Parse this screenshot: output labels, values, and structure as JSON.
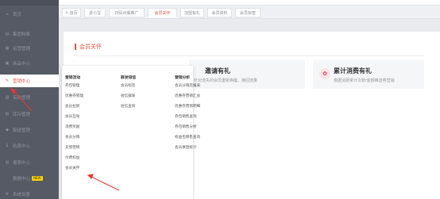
{
  "colors": {
    "accent": "#e0543e",
    "sidebar_bg": "#555a65",
    "arrow": "#e23b2e"
  },
  "sidebar": {
    "items": [
      {
        "label": "首页",
        "icon": "home-icon",
        "glyph": "⌂"
      },
      {
        "label": "集团档案",
        "icon": "group-icon",
        "glyph": "▤"
      },
      {
        "label": "运营管理",
        "icon": "operations-icon",
        "glyph": "▦"
      },
      {
        "label": "商品中心",
        "icon": "goods-icon",
        "glyph": "▣"
      },
      {
        "label": "营销中心",
        "icon": "marketing-icon",
        "glyph": "✎"
      },
      {
        "label": "采购管理",
        "icon": "purchase-icon",
        "glyph": "▨"
      },
      {
        "label": "库存管理",
        "icon": "inventory-icon",
        "glyph": "▧"
      },
      {
        "label": "配送管理",
        "icon": "delivery-icon",
        "glyph": "◆"
      },
      {
        "label": "结算中心",
        "icon": "settlement-icon",
        "glyph": "$"
      },
      {
        "label": "报表中心",
        "icon": "report-icon",
        "glyph": "▥"
      },
      {
        "label": "数据中心",
        "icon": "data-icon",
        "glyph": "",
        "badge": "NEW"
      },
      {
        "label": "系统设置",
        "icon": "settings-icon",
        "glyph": "⚙"
      }
    ],
    "active_index": 4
  },
  "tabs": [
    {
      "label": "首页",
      "icon": "home-icon",
      "glyph": "⌂"
    },
    {
      "label": "进小宝"
    },
    {
      "label": "扫码点餐推广"
    },
    {
      "label": "会员关怀"
    },
    {
      "label": "加盟有礼"
    },
    {
      "label": "会员资料"
    },
    {
      "label": "会员标签"
    }
  ],
  "active_tab": 3,
  "panel": {
    "title": "会员关怀",
    "cards": [
      {
        "title": "邀请有礼",
        "desc": "针对流失的会员重新唤醒、挽回流量"
      },
      {
        "title": "累计消费有礼",
        "desc": "根据消费累计次数/金额推送券营销",
        "icon": "gift-icon",
        "glyph": "✿"
      }
    ]
  },
  "dropdown": {
    "columns": [
      {
        "title": "营销活动",
        "items": [
          "券包管理",
          "优惠券管理",
          "会员拉新",
          "会员互动",
          "消费奖励",
          "会员分销",
          "充值营销",
          "付费权益",
          "会员关怀"
        ]
      },
      {
        "title": "群发短信",
        "items": [
          "会员标签",
          "短信群发",
          "短信查询"
        ]
      },
      {
        "title": "营销分析",
        "items": [
          "会员分销店报表",
          "优惠券营销汇总",
          "优惠券营销明细",
          "券包销售查询",
          "券包销售分析",
          "权益包销售查询",
          "会员拼团统计"
        ]
      }
    ]
  }
}
